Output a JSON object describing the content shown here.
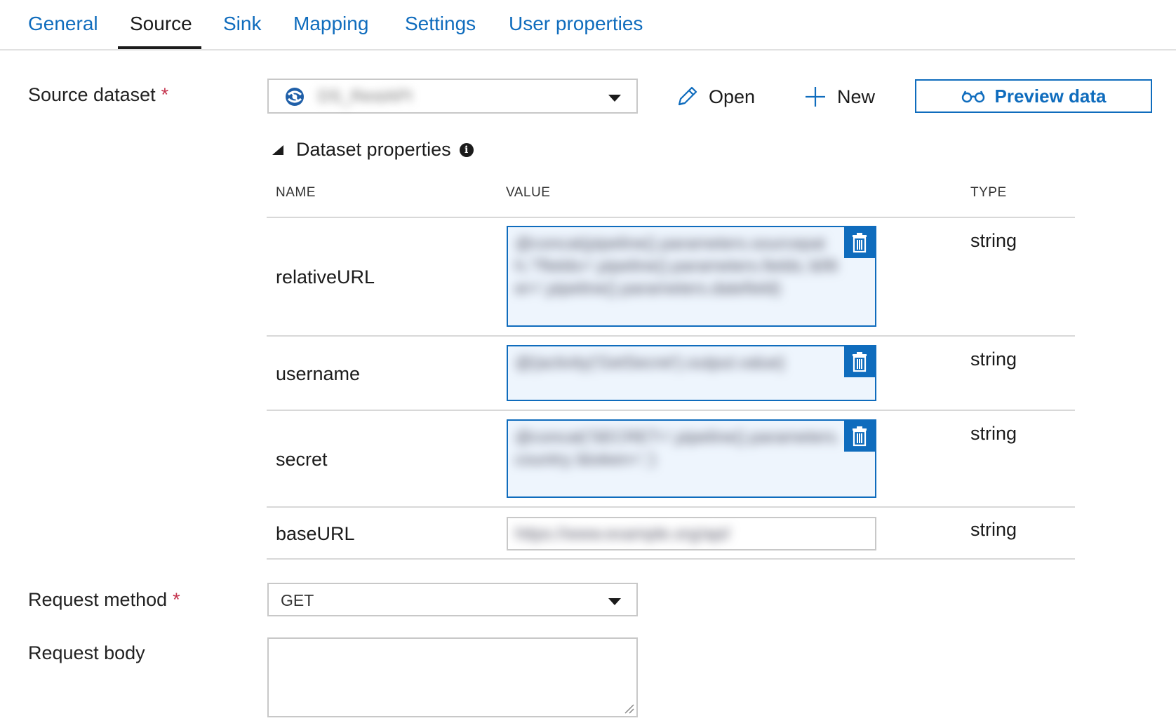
{
  "tabs": [
    {
      "label": "General",
      "active": false
    },
    {
      "label": "Source",
      "active": true
    },
    {
      "label": "Sink",
      "active": false
    },
    {
      "label": "Mapping",
      "active": false
    },
    {
      "label": "Settings",
      "active": false
    },
    {
      "label": "User properties",
      "active": false
    }
  ],
  "source": {
    "label": "Source dataset",
    "required_marker": "*",
    "selected_value": "DS_RestAPI",
    "dataset_icon": "rest-dataset-icon",
    "open_label": "Open",
    "new_label": "New",
    "preview_label": "Preview data"
  },
  "dataset_properties": {
    "title": "Dataset properties",
    "info_icon": "i",
    "columns": {
      "name": "NAME",
      "value": "VALUE",
      "type": "TYPE"
    },
    "rows": [
      {
        "name": "relativeURL",
        "value": "@concat(pipeline().parameters.sourcepath,'?fields=',pipeline().parameters.fields,'&filter=',pipeline().parameters.datefield)",
        "type": "string"
      },
      {
        "name": "username",
        "value": "@{activity('GetSecret').output.value}",
        "type": "string"
      },
      {
        "name": "secret",
        "value": "@concat('SECRET=',pipeline().parameters.country,'&token=',')",
        "type": "string"
      },
      {
        "name": "baseURL",
        "value": "https://www.example.org/api/",
        "type": "string"
      }
    ]
  },
  "request_method": {
    "label": "Request method",
    "required_marker": "*",
    "value": "GET"
  },
  "request_body": {
    "label": "Request body",
    "value": ""
  },
  "colors": {
    "accent": "#0f6cbd",
    "required": "#c4314b",
    "value_bg": "#eef5fd"
  }
}
